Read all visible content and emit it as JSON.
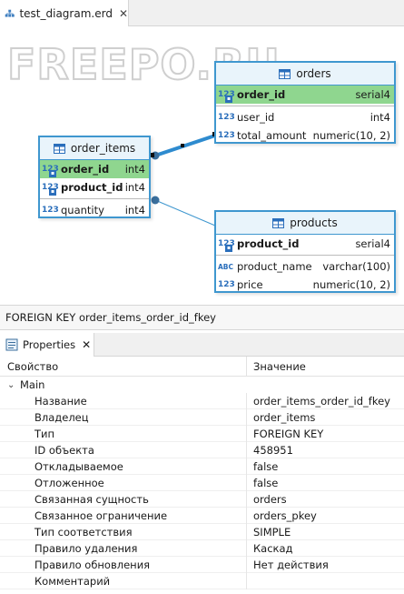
{
  "editor": {
    "tab_label": "test_diagram.erd",
    "tab_close": "✕",
    "watermark": "FREEPO.RU"
  },
  "entities": {
    "orders": {
      "name": "orders",
      "columns": [
        {
          "name": "order_id",
          "type": "serial4",
          "icon": "123"
        },
        {
          "name": "user_id",
          "type": "int4",
          "icon": "123"
        },
        {
          "name": "total_amount",
          "type": "numeric(10, 2)",
          "icon": "123"
        }
      ]
    },
    "order_items": {
      "name": "order_items",
      "columns": [
        {
          "name": "order_id",
          "type": "int4",
          "icon": "123"
        },
        {
          "name": "product_id",
          "type": "int4",
          "icon": "123"
        },
        {
          "name": "quantity",
          "type": "int4",
          "icon": "123"
        }
      ]
    },
    "products": {
      "name": "products",
      "columns": [
        {
          "name": "product_id",
          "type": "serial4",
          "icon": "123"
        },
        {
          "name": "product_name",
          "type": "varchar(100)",
          "icon": "ABC"
        },
        {
          "name": "price",
          "type": "numeric(10, 2)",
          "icon": "123"
        }
      ]
    }
  },
  "status_text": "FOREIGN KEY order_items_order_id_fkey",
  "properties_panel": {
    "tab_label": "Properties",
    "tab_close": "✕",
    "col_property": "Свойство",
    "col_value": "Значение",
    "group": "Main",
    "rows": [
      {
        "key": "Название",
        "value": "order_items_order_id_fkey"
      },
      {
        "key": "Владелец",
        "value": "order_items"
      },
      {
        "key": "Тип",
        "value": "FOREIGN KEY"
      },
      {
        "key": "ID объекта",
        "value": "458951"
      },
      {
        "key": "Откладываемое",
        "value": "false"
      },
      {
        "key": "Отложенное",
        "value": "false"
      },
      {
        "key": "Связанная сущность",
        "value": "orders"
      },
      {
        "key": "Связанное ограничение",
        "value": "orders_pkey"
      },
      {
        "key": "Тип соответствия",
        "value": "SIMPLE"
      },
      {
        "key": "Правило удаления",
        "value": "Каскад"
      },
      {
        "key": "Правило обновления",
        "value": "Нет действия"
      },
      {
        "key": "Комментарий",
        "value": ""
      }
    ]
  },
  "colors": {
    "entity_border": "#3f97cf",
    "entity_header": "#e9f4fb",
    "pk_highlight": "#8fd68f",
    "selected_link": "#2e8bcf"
  },
  "icons": [
    "diagram-icon",
    "table-icon",
    "numeric-column-icon",
    "text-column-icon",
    "key-icon",
    "properties-icon",
    "chevron-down-icon",
    "close-icon"
  ]
}
